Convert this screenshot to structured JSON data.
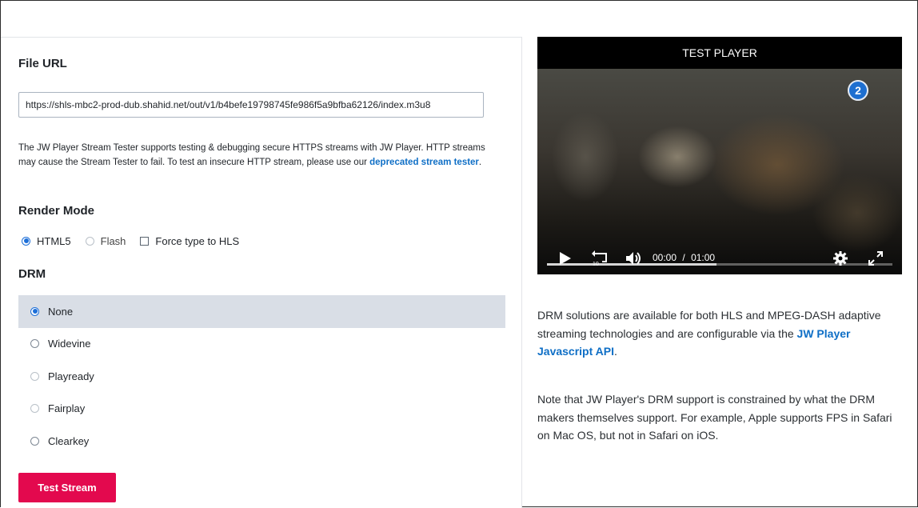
{
  "form": {
    "file_url_label": "File URL",
    "file_url_value": "https://shls-mbc2-prod-dub.shahid.net/out/v1/b4befe19798745fe986f5a9bfba62126/index.m3u8",
    "description_text": "The JW Player Stream Tester supports testing & debugging secure HTTPS streams with JW Player. HTTP streams may cause the Stream Tester to fail. To test an insecure HTTP stream, please use our ",
    "description_link": "deprecated stream tester",
    "description_end": ".",
    "render_mode_label": "Render Mode",
    "render_options": [
      {
        "label": "HTML5",
        "selected": true
      },
      {
        "label": "Flash",
        "selected": false
      }
    ],
    "force_hls_label": "Force type to HLS",
    "force_hls_checked": false,
    "drm_label": "DRM",
    "drm_options": [
      {
        "label": "None",
        "selected": true
      },
      {
        "label": "Widevine",
        "selected": false
      },
      {
        "label": "Playready",
        "selected": false
      },
      {
        "label": "Fairplay",
        "selected": false
      },
      {
        "label": "Clearkey",
        "selected": false
      }
    ],
    "test_button_label": "Test Stream"
  },
  "player": {
    "title": "TEST PLAYER",
    "channel_logo": "2",
    "current_time": "00:00",
    "separator": "/",
    "duration": "01:00",
    "buffered_fraction": 0.49,
    "icons": [
      "play-icon",
      "rewind-10-icon",
      "volume-icon",
      "settings-gear-icon",
      "fullscreen-icon"
    ]
  },
  "info": {
    "para1_text": "DRM solutions are available for both HLS and MPEG-DASH adaptive streaming technologies and are configurable via the ",
    "para1_link": "JW Player Javascript API",
    "para1_end": ".",
    "para2_text": "Note that JW Player's DRM support is constrained by what the DRM makers themselves support. For example, Apple supports FPS in Safari on Mac OS, but not in Safari on iOS."
  },
  "colors": {
    "accent": "#e3094e",
    "link": "#0f6fc6",
    "selected_row": "#d9dee6"
  }
}
